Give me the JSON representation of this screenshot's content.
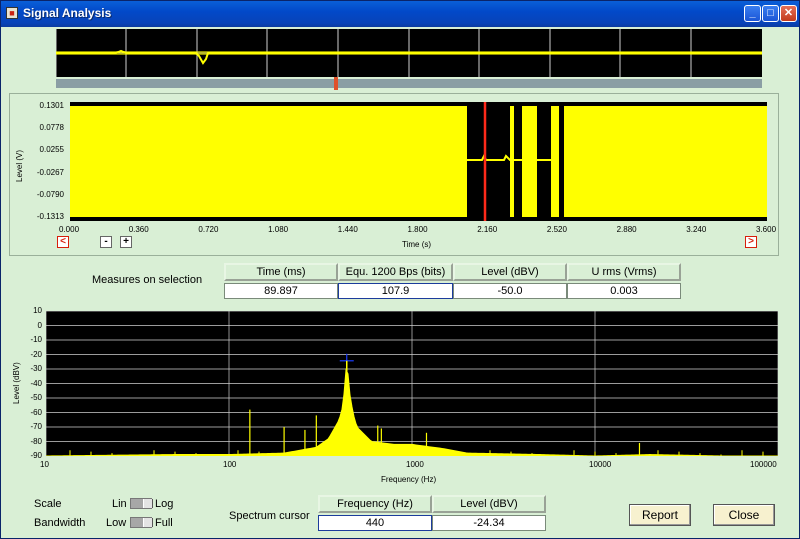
{
  "window": {
    "title": "Signal Analysis",
    "icon": "app-icon",
    "controls": {
      "minimize": "_",
      "maximize": "□",
      "close": "✕"
    }
  },
  "overview": {
    "scroll_position": 0.395
  },
  "waveform": {
    "y_ticks": [
      "0.1301",
      "0.0778",
      "0.0255",
      "-0.0267",
      "-0.0790",
      "-0.1313"
    ],
    "x_ticks": [
      "0.000",
      "0.360",
      "0.720",
      "1.080",
      "1.440",
      "1.800",
      "2.160",
      "2.520",
      "2.880",
      "3.240",
      "3.600"
    ],
    "ylabel": "Level (V)",
    "xlabel": "Time (s)",
    "color": "#ffff00",
    "cursor_color": "#ff2a1a",
    "cursor_time_s": 2.123,
    "buttons": {
      "prev": "<",
      "zoom_out": "-",
      "zoom_in": "+",
      "next": ">"
    }
  },
  "measures": {
    "label": "Measures on selection",
    "headers": [
      "Time (ms)",
      "Equ. 1200 Bps (bits)",
      "Level (dBV)",
      "U rms (Vrms)"
    ],
    "values": [
      "89.897",
      "107.9",
      "-50.0",
      "0.003"
    ]
  },
  "chart_data": {
    "type": "line",
    "title": "",
    "xlabel": "Frequency (Hz)",
    "ylabel": "Level (dBV)",
    "xscale": "log",
    "xlim": [
      10,
      100000
    ],
    "ylim": [
      -90,
      10
    ],
    "grid": true,
    "x_ticks": [
      "10",
      "100",
      "1000",
      "10000",
      "100000"
    ],
    "y_ticks": [
      "10",
      "0",
      "-10",
      "-20",
      "-30",
      "-40",
      "-50",
      "-60",
      "-70",
      "-80",
      "-90"
    ],
    "series": [
      {
        "x": [
          10,
          50,
          100,
          200,
          300,
          350,
          400,
          420,
          440,
          460,
          480,
          500,
          600,
          800,
          1000,
          1500,
          2000,
          5000,
          10000,
          20000,
          50000,
          100000
        ],
        "y": [
          -90,
          -89,
          -89,
          -88,
          -84,
          -78,
          -65,
          -55,
          -24.34,
          -50,
          -62,
          -70,
          -80,
          -82,
          -82,
          -85,
          -88,
          -89,
          -90,
          -89,
          -90,
          -90
        ]
      }
    ],
    "spikes": [
      {
        "x": 130,
        "y": -58
      },
      {
        "x": 200,
        "y": -70
      },
      {
        "x": 260,
        "y": -72
      },
      {
        "x": 300,
        "y": -62
      },
      {
        "x": 650,
        "y": -69
      },
      {
        "x": 680,
        "y": -71
      },
      {
        "x": 1200,
        "y": -74
      },
      {
        "x": 17500,
        "y": -81
      }
    ],
    "cursor": {
      "x": 440,
      "y": -24.34
    }
  },
  "spectrum_colors": {
    "trace": "#ffff00",
    "cursor": "#1a3cff",
    "background": "#000000",
    "grid": "#cfcfcf"
  },
  "controls": {
    "scale_label": "Scale",
    "scale_left": "Lin",
    "scale_right": "Log",
    "scale_value": "Log",
    "bandwidth_label": "Bandwidth",
    "bandwidth_left": "Low",
    "bandwidth_right": "Full",
    "bandwidth_value": "Full"
  },
  "spectrum_cursor": {
    "label": "Spectrum cursor",
    "headers": [
      "Frequency (Hz)",
      "Level (dBV)"
    ],
    "values": [
      "440",
      "-24.34"
    ]
  },
  "buttons": {
    "report": "Report",
    "close": "Close"
  }
}
